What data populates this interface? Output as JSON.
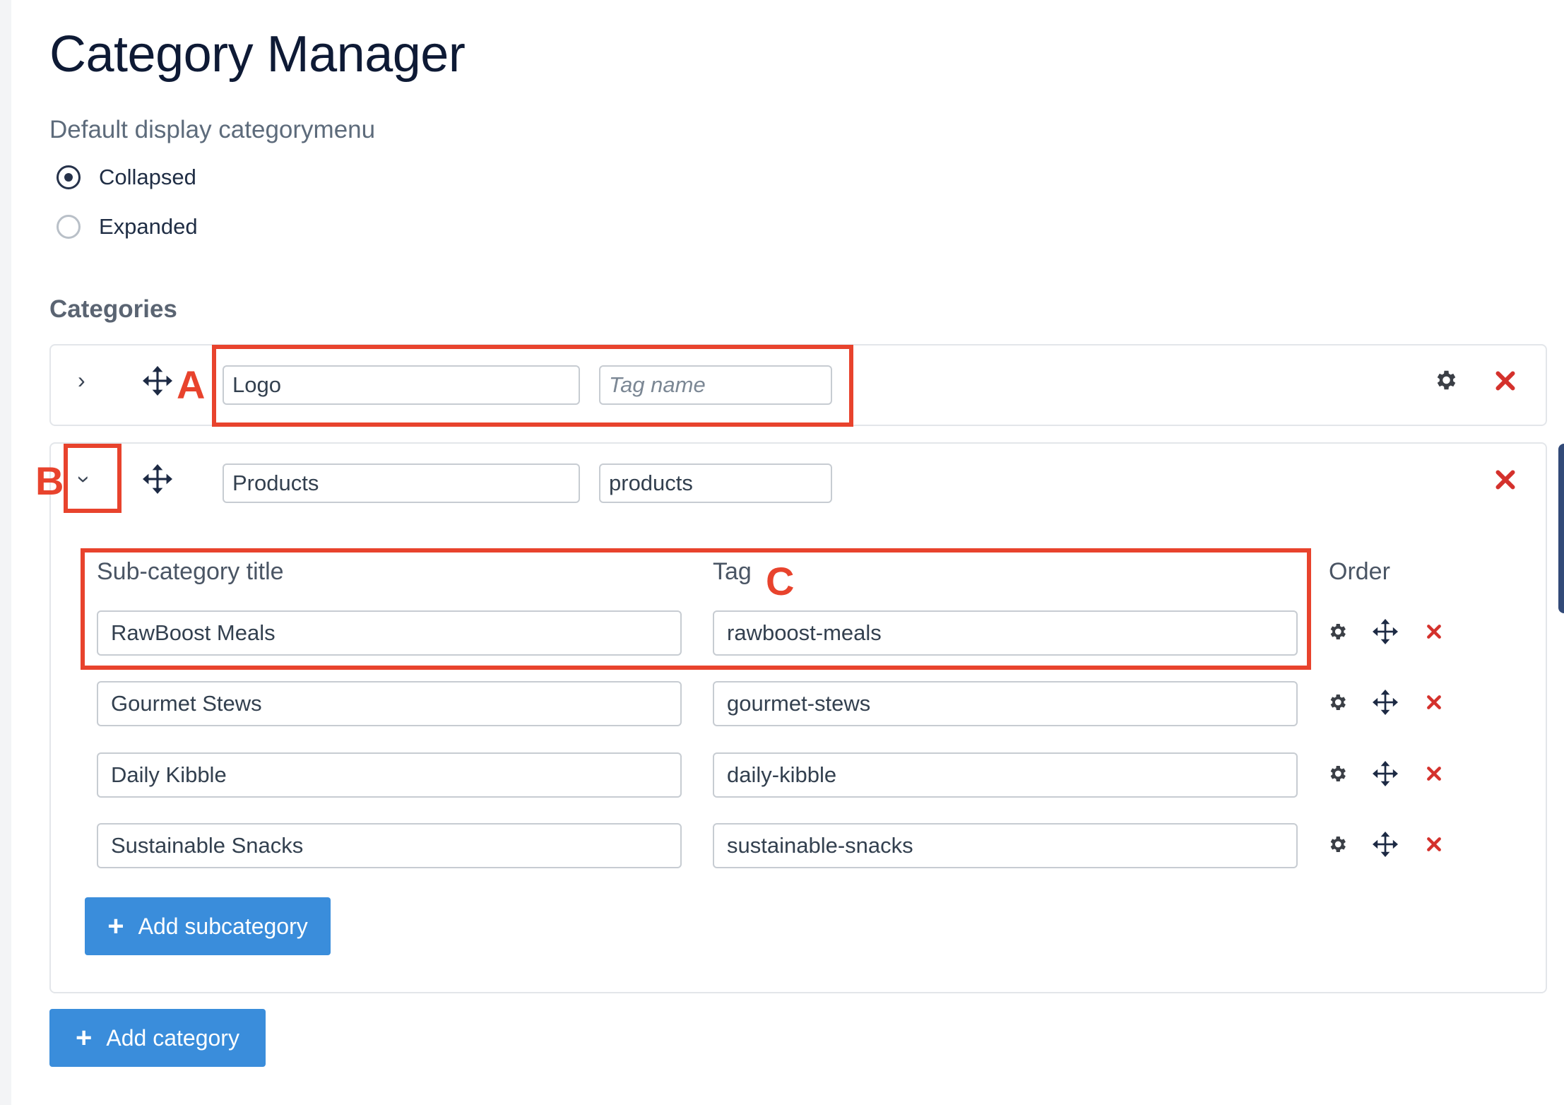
{
  "page": {
    "title": "Category Manager",
    "display_label": "Default display categorymenu",
    "radio_options": [
      {
        "label": "Collapsed",
        "checked": true
      },
      {
        "label": "Expanded",
        "checked": false
      }
    ],
    "categories_label": "Categories"
  },
  "categories": [
    {
      "title": "Logo",
      "tag": "",
      "tag_placeholder": "Tag name",
      "expanded": false
    },
    {
      "title": "Products",
      "tag": "products",
      "expanded": true,
      "subcategory_headers": {
        "title": "Sub-category title",
        "tag": "Tag",
        "order": "Order"
      },
      "subcategories": [
        {
          "title": "RawBoost Meals",
          "tag": "rawboost-meals"
        },
        {
          "title": "Gourmet Stews",
          "tag": "gourmet-stews"
        },
        {
          "title": "Daily Kibble",
          "tag": "daily-kibble"
        },
        {
          "title": "Sustainable Snacks",
          "tag": "sustainable-snacks"
        }
      ],
      "add_subcategory_label": "Add subcategory"
    }
  ],
  "add_category_label": "Add category",
  "annotations": {
    "a": "A",
    "b": "B",
    "c": "C"
  },
  "colors": {
    "accent_button": "#3a8ddb",
    "delete_red": "#d4312c",
    "annotation_red": "#e8432d",
    "title_navy": "#0e1a35"
  },
  "icons": {
    "expand_collapsed": "chevron-right-icon",
    "expand_open": "chevron-down-icon",
    "drag": "move-icon",
    "settings": "gear-icon",
    "delete": "close-icon",
    "add": "plus-icon"
  }
}
